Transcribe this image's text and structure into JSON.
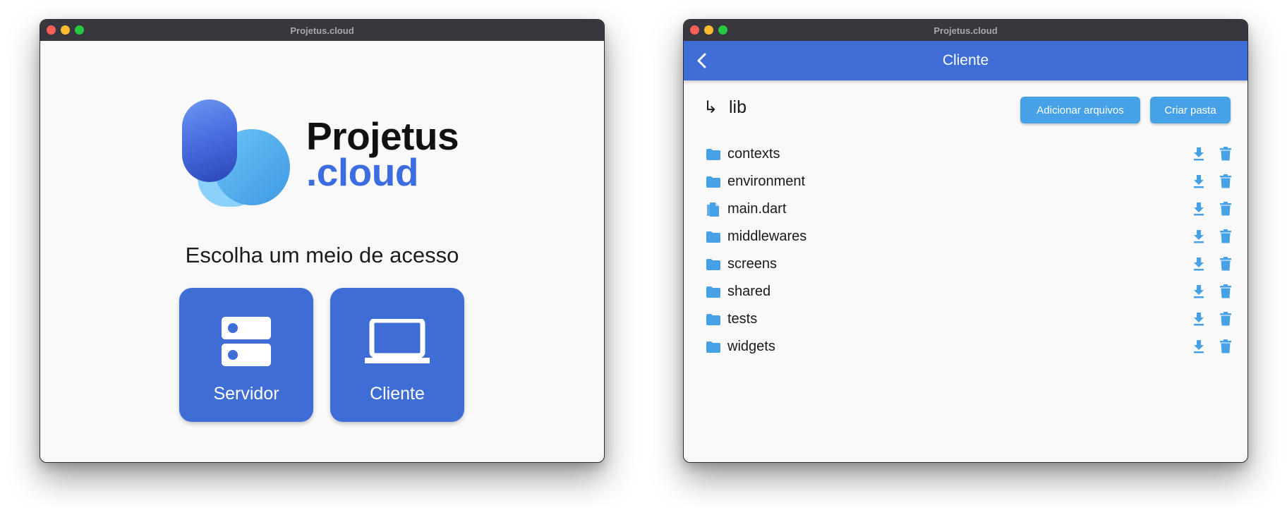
{
  "windows": {
    "left": {
      "title": "Projetus.cloud",
      "logo": {
        "word1": "Projetus",
        "word2": ".cloud"
      },
      "prompt": "Escolha um meio de acesso",
      "cards": [
        {
          "label": "Servidor",
          "icon": "server-icon"
        },
        {
          "label": "Cliente",
          "icon": "laptop-icon"
        }
      ]
    },
    "right": {
      "title": "Projetus.cloud",
      "appbar_title": "Cliente",
      "path": {
        "arrow": "↳",
        "name": "lib"
      },
      "buttons": {
        "add_files": "Adicionar arquivos",
        "new_folder": "Criar pasta"
      },
      "files": [
        {
          "name": "contexts",
          "type": "folder"
        },
        {
          "name": "environment",
          "type": "folder"
        },
        {
          "name": "main.dart",
          "type": "file"
        },
        {
          "name": "middlewares",
          "type": "folder"
        },
        {
          "name": "screens",
          "type": "folder"
        },
        {
          "name": "shared",
          "type": "folder"
        },
        {
          "name": "tests",
          "type": "folder"
        },
        {
          "name": "widgets",
          "type": "folder"
        }
      ]
    }
  },
  "colors": {
    "primary": "#3f6dd6",
    "accent": "#46a1e6",
    "titlebar": "#38373d",
    "background": "#f9f9f9"
  }
}
